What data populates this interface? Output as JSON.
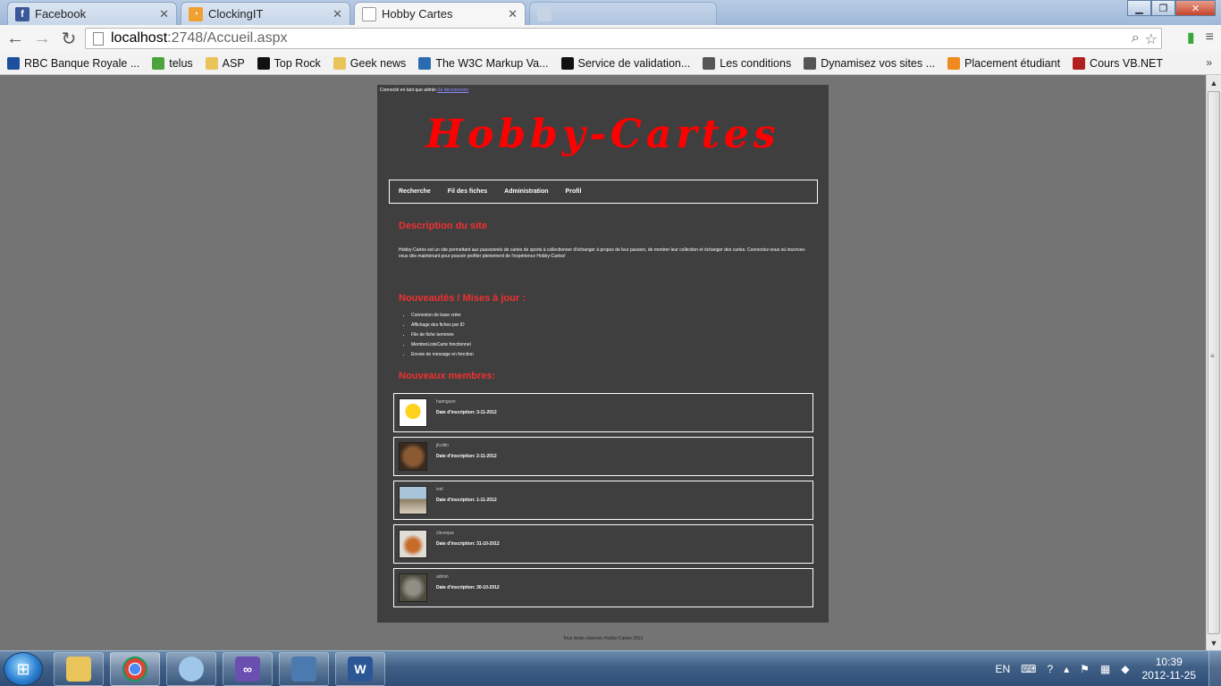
{
  "browser": {
    "tabs": [
      {
        "title": "Facebook",
        "color": "#3b5998",
        "glyph": "f"
      },
      {
        "title": "ClockingIT",
        "color": "#f0a030",
        "glyph": "◔"
      },
      {
        "title": "Hobby Cartes",
        "color": "#ffffff",
        "glyph": ""
      },
      {
        "title": "",
        "color": "#cfd9e6",
        "glyph": ""
      }
    ],
    "url_host": "localhost",
    "url_path": ":2748/Accueil.aspx",
    "bookmarks": [
      {
        "label": "RBC Banque Royale ...",
        "color": "#1d4f9c"
      },
      {
        "label": "telus",
        "color": "#4aa33b"
      },
      {
        "label": "ASP",
        "color": "#e8c45a"
      },
      {
        "label": "Top Rock",
        "color": "#111111"
      },
      {
        "label": "Geek news",
        "color": "#e8c45a"
      },
      {
        "label": "The W3C Markup Va...",
        "color": "#2b6cb0"
      },
      {
        "label": "Service de validation...",
        "color": "#111111"
      },
      {
        "label": "Les conditions",
        "color": "#555555"
      },
      {
        "label": "Dynamisez vos sites ...",
        "color": "#555555"
      },
      {
        "label": "Placement étudiant",
        "color": "#f08a1c"
      },
      {
        "label": "Cours VB.NET",
        "color": "#b02020"
      }
    ],
    "bookmarks_more": "»"
  },
  "site": {
    "login_text": "Connecté en tant que admin",
    "logout_link": "Se déconnecter",
    "logo": "Hobby-Cartes",
    "menu": [
      "Recherche",
      "Fil des fiches",
      "Administration",
      "Profil"
    ],
    "description_title": "Description du site",
    "description_text": "Hobby-Cartes est un site permettant aux passionnés de cartes de sports à collectionner d'échanger à propos de leur passion, de montrer leur collection et échanger des cartes. Connectez-vous où inscrivez-vous dès maintenant pour pouvoir profiter pleinement de l'expérience Hobby-Cartes!",
    "news_title": "Nouveautés / Mises à jour :",
    "news_items": [
      "Connexion de base créer",
      "Affichage des fiches par ID",
      "File de fiche terminée",
      "MembreListeCarte fonctionnel",
      "Envoie de message en fonction"
    ],
    "members_title": "Nouveaux membres:",
    "members": [
      {
        "name": "haimgson",
        "date": "Date d'inscription: 3-11-2012",
        "avatar": "homer"
      },
      {
        "name": "jfcollin",
        "date": "Date d'inscription: 2-11-2012",
        "avatar": "bear"
      },
      {
        "name": "ivel",
        "date": "Date d'inscription: 1-11-2012",
        "avatar": "caribou"
      },
      {
        "name": "cleveque",
        "date": "Date d'inscription: 31-10-2012",
        "avatar": "fox"
      },
      {
        "name": "admin",
        "date": "Date d'inscription: 30-10-2012",
        "avatar": "wolf"
      }
    ],
    "footer": "Tous droits réservés Hobby-Cartes 2012"
  },
  "taskbar": {
    "language": "EN",
    "time": "10:39",
    "date": "2012-11-25"
  }
}
